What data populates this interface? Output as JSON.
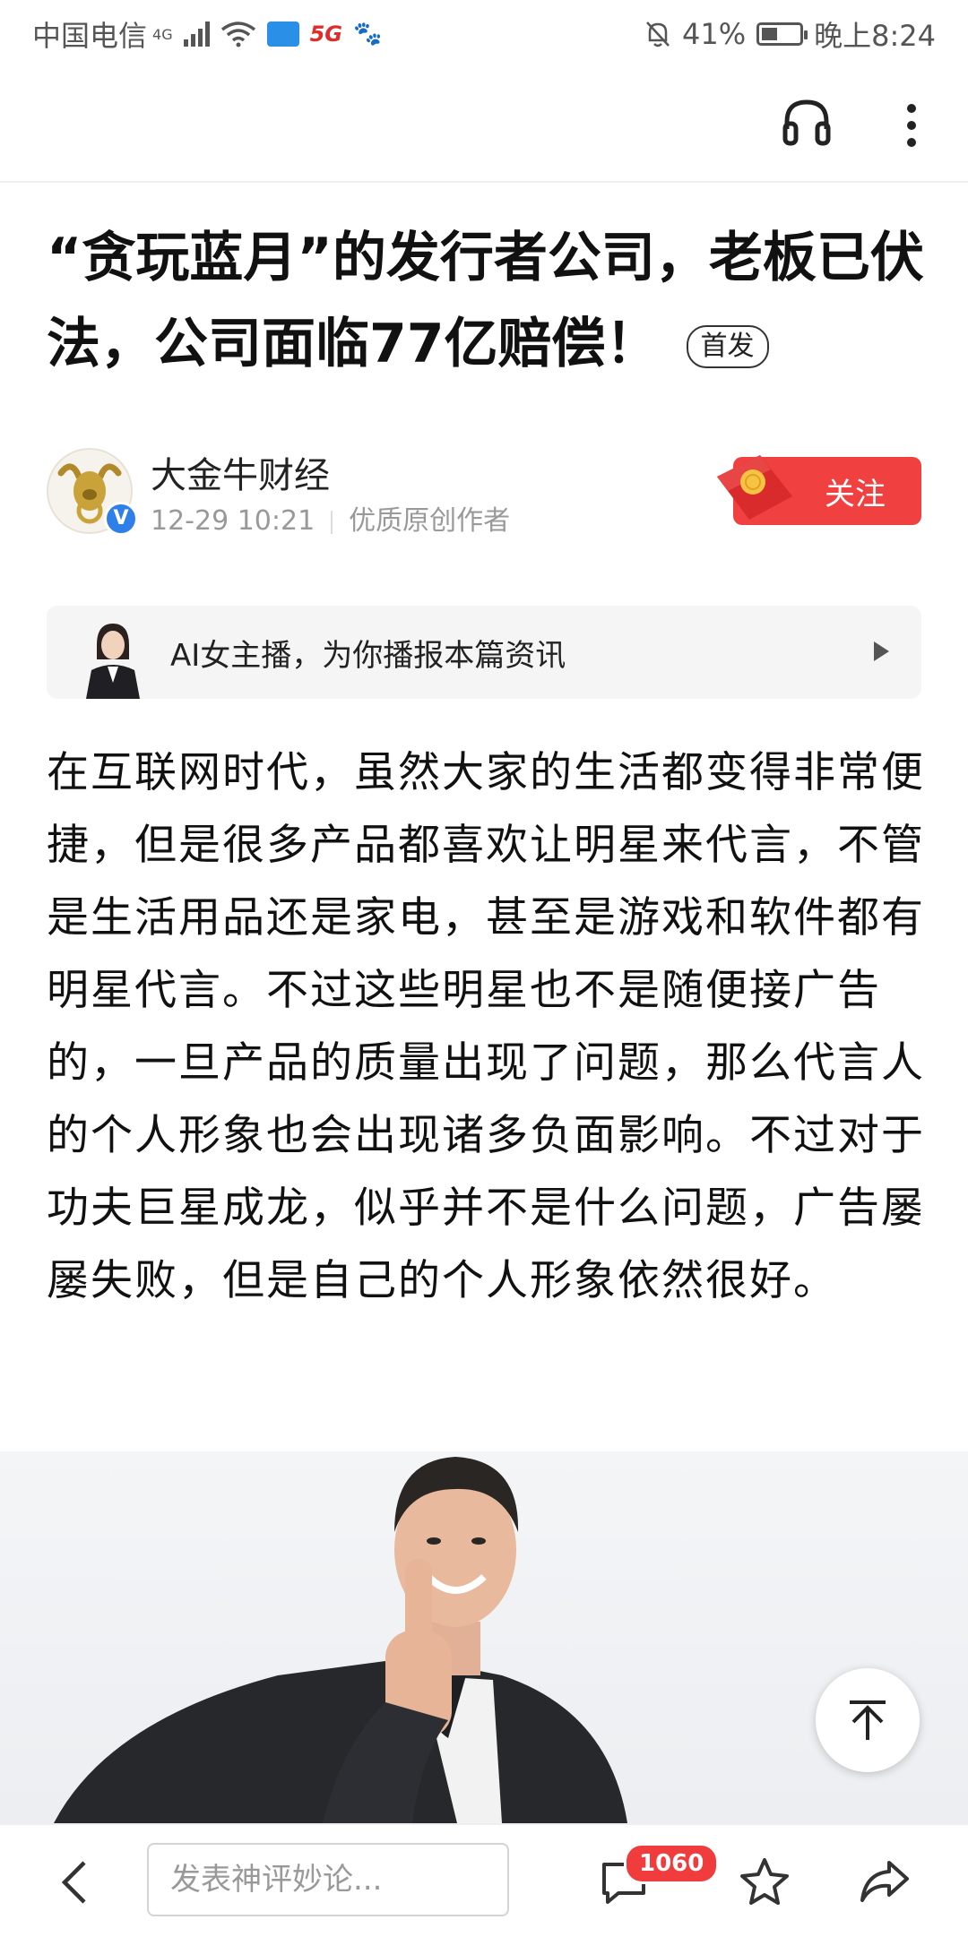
{
  "status_bar": {
    "carrier": "中国电信",
    "network": "4G",
    "battery": "41%",
    "battery_level": 0.41,
    "time": "晚上8:24",
    "icons": [
      "signal-icon",
      "wifi-icon",
      "message-icon",
      "5g-app-icon",
      "baidu-icon",
      "mute-icon",
      "battery-icon"
    ]
  },
  "top_bar": {
    "icons": [
      "headphone-icon",
      "more-icon"
    ]
  },
  "article": {
    "title": "“贪玩蓝月”的发行者公司，老板已伏法，公司面临77亿赔偿！",
    "badge": "首发",
    "author": {
      "name": "大金牛财经",
      "date": "12-29 10:21",
      "tag": "优质原创作者",
      "follow_label": "关注",
      "verified": "V"
    },
    "ai_banner": {
      "label": "AI女主播，为你播报本篇资讯"
    },
    "body": "在互联网时代，虽然大家的生活都变得非常便捷，但是很多产品都喜欢让明星来代言，不管是生活用品还是家电，甚至是游戏和软件都有明星代言。不过这些明星也不是随便接广告的，一旦产品的质量出现了问题，那么代言人的个人形象也会出现诸多负面影响。不过对于功夫巨星成龙，似乎并不是什么问题，广告屡屡失败，但是自己的个人形象依然很好。"
  },
  "bottom_bar": {
    "comment_placeholder": "发表神评妙论...",
    "comment_count": "1060",
    "icons": [
      "back-icon",
      "comment-icon",
      "star-icon",
      "share-icon",
      "back-to-top-icon"
    ]
  },
  "colors": {
    "accent_red": "#f04040",
    "verified_blue": "#2f7fe8",
    "meta_gray": "#999999"
  }
}
